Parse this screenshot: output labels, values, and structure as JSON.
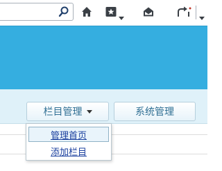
{
  "browser_toolbar": {
    "icons": [
      "search-icon",
      "home-icon",
      "favorites-icon",
      "read-mail-icon",
      "feedback-icon"
    ]
  },
  "nav": {
    "column_management": "栏目管理",
    "system_management": "系统管理"
  },
  "dropdown": {
    "items": [
      {
        "label": "管理首页",
        "active": true
      },
      {
        "label": "添加栏目",
        "active": false
      }
    ]
  },
  "colors": {
    "banner": "#35aee0",
    "nav_bg": "#dff1f9",
    "nav_text": "#2f6f93",
    "link": "#1a3f9e"
  }
}
